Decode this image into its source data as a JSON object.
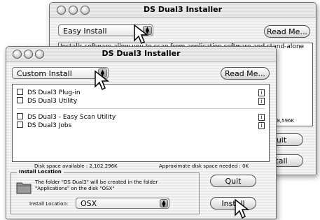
{
  "back_window": {
    "title": "DS Dual3 Installer",
    "popup_value": "Easy Install",
    "readme_label": "Read Me...",
    "description": "Installs software allow you to scan from application software and stand-alone",
    "disk_needed": "d: 18,596K",
    "quit_label": "uit",
    "install_label": "tall"
  },
  "front_window": {
    "title": "DS Dual3 Installer",
    "popup_value": "Custom Install",
    "readme_label": "Read Me...",
    "items": [
      "DS Dual3 Plug-in",
      "DS Dual3 Utility",
      "DS Dual3 - Easy Scan Utility",
      "DS Dual3 Jobs"
    ],
    "disk_available": "Disk space available : 2,102,296K",
    "disk_needed": "Approximate disk space needed : 0K",
    "location_group_label": "Install Location",
    "location_text_line1": "The folder \"DS Dual3\" will be created in the folder",
    "location_text_line2": "\"Applications\" on the disk \"OSX\"",
    "location_label": "Install Location:",
    "location_value": "OSX",
    "quit_label": "Quit",
    "install_label": "Install"
  },
  "icons": [
    "arrow-cursor-icon",
    "folder-icon",
    "info-icon",
    "popup-arrows-icon"
  ]
}
